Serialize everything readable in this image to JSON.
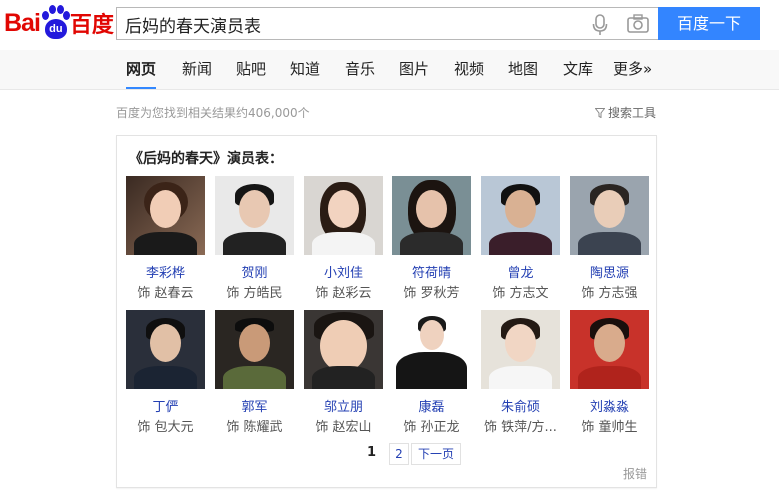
{
  "logo": {
    "latin": "Bai",
    "paw_text": "du",
    "chinese": "百度"
  },
  "search": {
    "query": "后妈的春天演员表",
    "button_label": "百度一下"
  },
  "nav": {
    "items": [
      {
        "label": "网页"
      },
      {
        "label": "新闻"
      },
      {
        "label": "贴吧"
      },
      {
        "label": "知道"
      },
      {
        "label": "音乐"
      },
      {
        "label": "图片"
      },
      {
        "label": "视频"
      },
      {
        "label": "地图"
      },
      {
        "label": "文库"
      },
      {
        "label": "更多»"
      }
    ]
  },
  "results": {
    "info": "百度为您找到相关结果约406,000个",
    "tools_label": "搜索工具"
  },
  "card": {
    "title": "《后妈的春天》演员表：",
    "cast": [
      {
        "name": "李彩桦",
        "role": "饰 赵春云"
      },
      {
        "name": "贺刚",
        "role": "饰 方皓民"
      },
      {
        "name": "小刘佳",
        "role": "饰 赵彩云"
      },
      {
        "name": "符荷晴",
        "role": "饰 罗秋芳"
      },
      {
        "name": "曾龙",
        "role": "饰 方志文"
      },
      {
        "name": "陶思源",
        "role": "饰 方志强"
      },
      {
        "name": "丁俨",
        "role": "饰 包大元"
      },
      {
        "name": "郭军",
        "role": "饰 陈耀武"
      },
      {
        "name": "邬立朋",
        "role": "饰 赵宏山"
      },
      {
        "name": "康磊",
        "role": "饰 孙正龙"
      },
      {
        "name": "朱俞硕",
        "role": "饰 铁萍/方..."
      },
      {
        "name": "刘淼淼",
        "role": "饰 童帅生"
      }
    ],
    "pager": {
      "current": "1",
      "page2": "2",
      "next": "下一页"
    },
    "report": "报错"
  }
}
